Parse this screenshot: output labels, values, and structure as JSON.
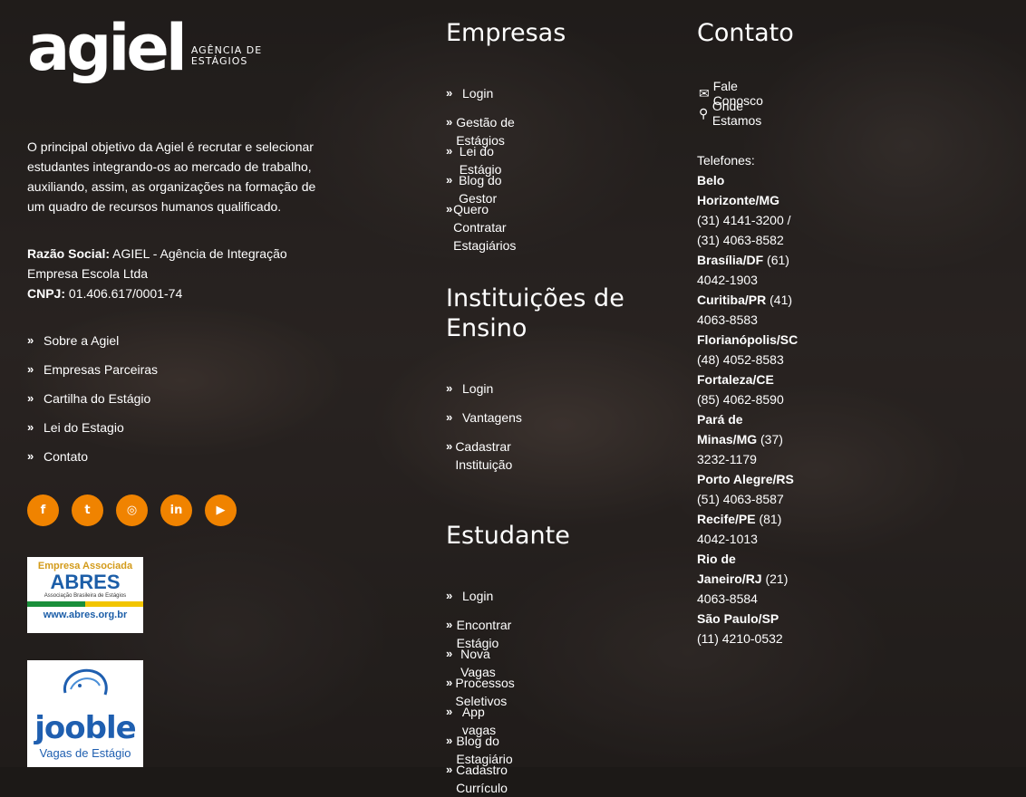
{
  "logo": {
    "word": "agiel",
    "sub_line1": "AGÊNCIA DE",
    "sub_line2": "ESTÁGIOS"
  },
  "about": "O principal objetivo da Agiel é recrutar e selecionar estudantes integrando-os ao mercado de trabalho, auxiliando, assim, as organizações na formação de um quadro de recursos humanos qualificado.",
  "company": {
    "razao_label": "Razão Social:",
    "razao_value": " AGIEL - Agência de Integração Empresa Escola Ltda",
    "cnpj_label": "CNPJ:",
    "cnpj_value": " 01.406.617/0001-74"
  },
  "left_links": [
    "Sobre a Agiel",
    "Empresas Parceiras",
    "Cartilha do Estágio",
    "Lei do Estagio",
    "Contato"
  ],
  "social": {
    "accent": "#f08300",
    "icons": [
      "facebook-icon",
      "twitter-icon",
      "instagram-icon",
      "linkedin-icon",
      "youtube-icon"
    ],
    "glyphs": [
      "f",
      "t",
      "◎",
      "in",
      "▶"
    ]
  },
  "abres": {
    "line1": "Empresa Associada",
    "line2": "ABRES",
    "line3": "Associação Brasileira de Estágios",
    "line4": "www.abres.org.br"
  },
  "jooble": {
    "name": "jooble",
    "tagline": "Vagas de Estágio"
  },
  "empresas": {
    "title": "Empresas",
    "links": [
      "Login",
      "Gestão de Estágios",
      "Lei do Estágio",
      "Blog do Gestor",
      "Quero Contratar Estagiários"
    ]
  },
  "instituicoes": {
    "title": "Instituições de Ensino",
    "links": [
      "Login",
      "Vantagens",
      "Cadastrar Instituição"
    ]
  },
  "estudante": {
    "title": "Estudante",
    "links": [
      "Login",
      "Encontrar Estágio",
      "Nova Vagas",
      "Processos Seletivos",
      "App vagas",
      "Blog do Estagiário",
      "Cadastro Currículo"
    ]
  },
  "contato": {
    "title": "Contato",
    "fale": "Fale Conosco",
    "onde": "Onde Estamos",
    "phones_label": "Telefones:",
    "phones": [
      {
        "city": "Belo Horizonte/MG",
        "number": " (31) 4141-3200 / (31) 4063-8582"
      },
      {
        "city": "Brasília/DF",
        "number": " (61) 4042-1903"
      },
      {
        "city": "Curitiba/PR",
        "number": " (41) 4063-8583"
      },
      {
        "city": "Florianópolis/SC",
        "number": " (48) 4052-8583"
      },
      {
        "city": "Fortaleza/CE",
        "number": " (85) 4062-8590"
      },
      {
        "city": "Pará de Minas/MG",
        "number": " (37) 3232-1179"
      },
      {
        "city": "Porto Alegre/RS",
        "number": " (51) 4063-8587"
      },
      {
        "city": "Recife/PE",
        "number": " (81) 4042-1013"
      },
      {
        "city": "Rio de Janeiro/RJ",
        "number": " (21) 4063-8584"
      },
      {
        "city": "São Paulo/SP",
        "number": " (11) 4210-0532"
      }
    ]
  }
}
